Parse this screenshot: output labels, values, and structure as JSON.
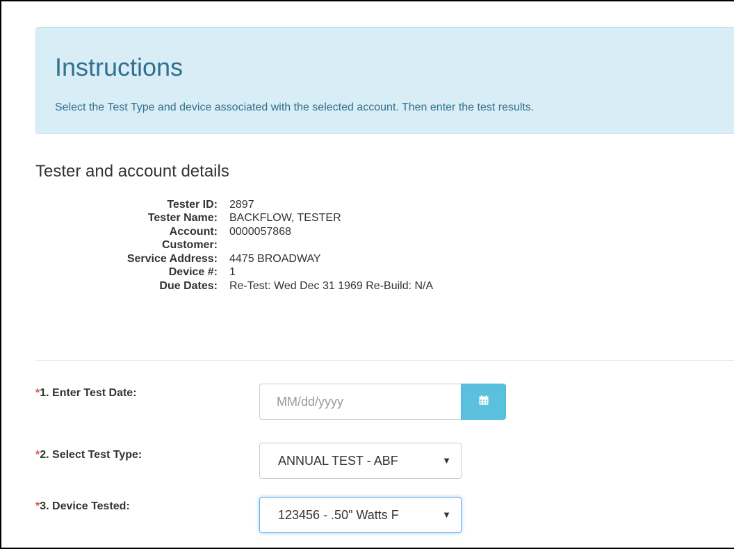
{
  "instructions": {
    "title": "Instructions",
    "text": "Select the Test Type and device associated with the selected account. Then enter the test results."
  },
  "details": {
    "heading": "Tester and account details",
    "rows": [
      {
        "label": "Tester ID:",
        "value": "2897"
      },
      {
        "label": "Tester Name:",
        "value": "BACKFLOW, TESTER"
      },
      {
        "label": "Account:",
        "value": "0000057868"
      },
      {
        "label": "Customer:",
        "value": ""
      },
      {
        "label": "Service Address:",
        "value": "4475 BROADWAY"
      },
      {
        "label": "Device #:",
        "value": "1"
      },
      {
        "label": "Due Dates:",
        "value": "Re-Test: Wed Dec 31 1969 Re-Build: N/A"
      }
    ]
  },
  "form": {
    "required_mark": "*",
    "test_date": {
      "label": "1. Enter Test Date:",
      "value": "",
      "placeholder": "MM/dd/yyyy",
      "icon": "calendar-icon"
    },
    "test_type": {
      "label": "2. Select Test Type:",
      "selected": "ANNUAL TEST - ABF"
    },
    "device": {
      "label": "3. Device Tested:",
      "selected": "123456 - .50\" Watts F"
    }
  },
  "colors": {
    "alert_bg": "#d9edf7",
    "alert_text": "#31708f",
    "required": "#d9534f",
    "calendar_button": "#5bc0de",
    "focus_border": "#66afe9"
  }
}
